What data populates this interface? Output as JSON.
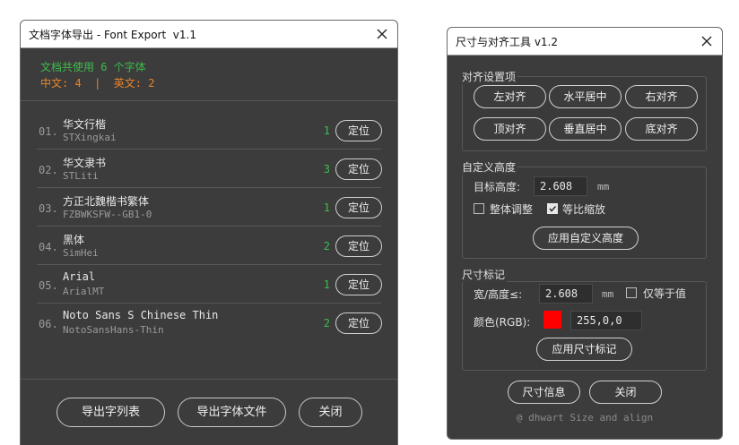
{
  "font_export": {
    "title": "文档字体导出 - Font Export  v1.1",
    "summary_line1": "文档共使用 6 个字体",
    "summary_line2": "中文: 4  |  英文: 2",
    "fonts": [
      {
        "num": "01.",
        "name": "华文行楷",
        "ps": "STXingkai",
        "count": "1",
        "locate": "定位"
      },
      {
        "num": "02.",
        "name": "华文隶书",
        "ps": "STLiti",
        "count": "3",
        "locate": "定位"
      },
      {
        "num": "03.",
        "name": "方正北魏楷书繁体",
        "ps": "FZBWKSFW--GB1-0",
        "count": "1",
        "locate": "定位"
      },
      {
        "num": "04.",
        "name": "黑体",
        "ps": "SimHei",
        "count": "2",
        "locate": "定位"
      },
      {
        "num": "05.",
        "name": "Arial",
        "ps": "ArialMT",
        "count": "1",
        "locate": "定位"
      },
      {
        "num": "06.",
        "name": "Noto Sans S Chinese Thin",
        "ps": "NotoSansHans-Thin",
        "count": "2",
        "locate": "定位"
      }
    ],
    "buttons": {
      "export_list": "导出字列表",
      "export_files": "导出字体文件",
      "close": "关闭"
    }
  },
  "align_tool": {
    "title": "尺寸与对齐工具 v1.2",
    "align_group": {
      "label": "对齐设置项",
      "buttons": [
        "左对齐",
        "水平居中",
        "右对齐",
        "顶对齐",
        "垂直居中",
        "底对齐"
      ]
    },
    "height_group": {
      "label": "自定义高度",
      "target_label": "目标高度:",
      "target_value": "2.608",
      "unit": "mm",
      "overall_label": "整体调整",
      "overall_checked": false,
      "proportional_label": "等比缩放",
      "proportional_checked": true,
      "apply_label": "应用自定义高度"
    },
    "mark_group": {
      "label": "尺寸标记",
      "size_label": "宽/高度≤:",
      "size_value": "2.608",
      "unit": "mm",
      "equal_label": "仅等于值",
      "equal_checked": false,
      "color_label": "颜色(RGB):",
      "color_swatch": "#ff0000",
      "color_value": "255,0,0",
      "apply_label": "应用尺寸标记"
    },
    "buttons": {
      "info": "尺寸信息",
      "close": "关闭"
    },
    "credit": "@ dhwart Size and align"
  }
}
